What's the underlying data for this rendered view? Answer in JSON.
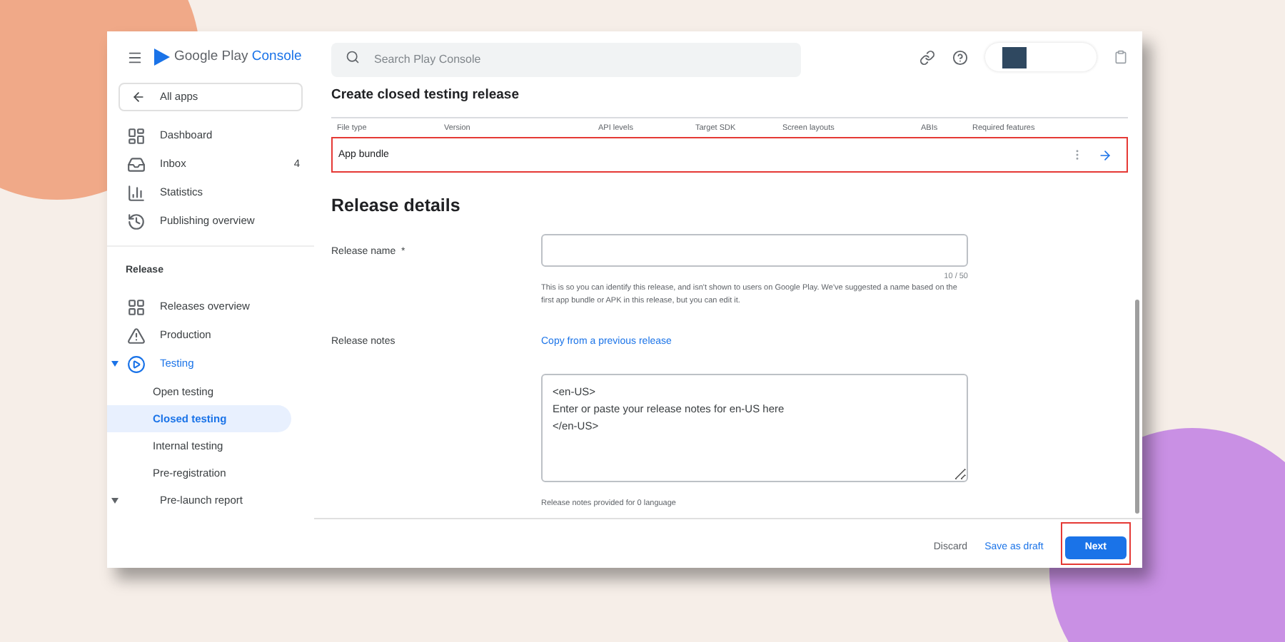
{
  "brand": {
    "name": "Google Play",
    "suffix": "Console"
  },
  "back_link": "All apps",
  "sidebar": {
    "items": [
      {
        "kind": "dashboard",
        "label": "Dashboard"
      },
      {
        "kind": "inbox",
        "label": "Inbox",
        "count": "4"
      },
      {
        "kind": "statistics",
        "label": "Statistics"
      },
      {
        "kind": "publishing",
        "label": "Publishing overview"
      }
    ],
    "section": "Release",
    "release_items": [
      {
        "kind": "releases",
        "label": "Releases overview"
      },
      {
        "kind": "production",
        "label": "Production"
      },
      {
        "kind": "testing",
        "label": "Testing",
        "expanded": true,
        "children": [
          {
            "label": "Open testing",
            "selected": false
          },
          {
            "label": "Closed testing",
            "selected": true
          },
          {
            "label": "Internal testing",
            "selected": false
          },
          {
            "label": "Pre-registration",
            "selected": false
          }
        ]
      },
      {
        "kind": "prelaunch",
        "label": "Pre-launch report",
        "expanded": false
      }
    ]
  },
  "search": {
    "placeholder": "Search Play Console"
  },
  "page_title": "Create closed testing release",
  "table": {
    "columns": [
      "File type",
      "Version",
      "API levels",
      "Target SDK",
      "Screen layouts",
      "ABIs",
      "Required features"
    ],
    "rows": [
      {
        "file_type": "App bundle",
        "highlighted": true
      }
    ]
  },
  "section_title": "Release details",
  "release_name": {
    "label": "Release name",
    "required_mark": "*",
    "counter": "10 / 50",
    "help": "This is so you can identify this release, and isn't shown to users on Google Play. We've suggested a name based on the first app bundle or APK in this release, but you can edit it."
  },
  "release_notes": {
    "label": "Release notes",
    "copy_link": "Copy from a previous release",
    "value": "<en-US>\nEnter or paste your release notes for en-US here\n</en-US>",
    "provided": "Release notes provided for 0 language"
  },
  "footer": {
    "buttons": [
      {
        "label": "Discard",
        "kind": "plain",
        "highlighted": false
      },
      {
        "label": "Save as draft",
        "kind": "link",
        "highlighted": false
      },
      {
        "label": "Next",
        "kind": "primary",
        "highlighted": true
      }
    ]
  }
}
